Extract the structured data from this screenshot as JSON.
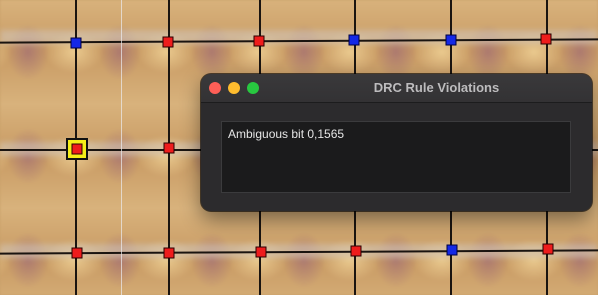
{
  "window": {
    "title": "DRC Rule Violations",
    "message": "Ambiguous bit 0,1565"
  },
  "markers": [
    {
      "id": "r1c1",
      "color": "blue"
    },
    {
      "id": "r1c2",
      "color": "red"
    },
    {
      "id": "r1c3",
      "color": "red"
    },
    {
      "id": "r1c4",
      "color": "blue"
    },
    {
      "id": "r1c5",
      "color": "blue"
    },
    {
      "id": "r1c6",
      "color": "red"
    },
    {
      "id": "r2c1",
      "color": "red",
      "selected": true
    },
    {
      "id": "r2c2",
      "color": "red"
    },
    {
      "id": "r3c1",
      "color": "red"
    },
    {
      "id": "r3c2",
      "color": "red"
    },
    {
      "id": "r3c3",
      "color": "red"
    },
    {
      "id": "r3c4",
      "color": "red"
    },
    {
      "id": "r3c5",
      "color": "blue"
    },
    {
      "id": "r3c6",
      "color": "red"
    }
  ],
  "colors": {
    "red_marker": "#ee1c1c",
    "blue_marker": "#1428e6",
    "selection": "#f5ee18",
    "dialog_bg": "#2c2b2d",
    "text_area_bg": "#1b1b1c"
  }
}
